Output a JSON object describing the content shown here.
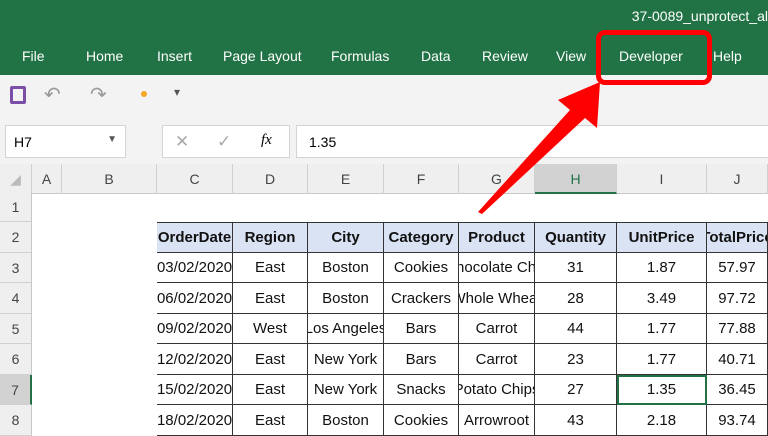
{
  "window": {
    "title": "37-0089_unprotect_al"
  },
  "menu": [
    "File",
    "Home",
    "Insert",
    "Page Layout",
    "Formulas",
    "Data",
    "Review",
    "View",
    "Developer",
    "Help"
  ],
  "colors": {
    "ribbon": "#217346",
    "highlight": "#ff0000",
    "selection": "#217346",
    "header_fill": "#dae3f3"
  },
  "qat": {
    "icons": [
      "save-icon",
      "undo-icon",
      "redo-icon",
      "touch-mode-icon",
      "customize-icon"
    ]
  },
  "formula_bar": {
    "name_box": "H7",
    "fx": "fx",
    "value": "1.35"
  },
  "columns": [
    "A",
    "B",
    "C",
    "D",
    "E",
    "F",
    "G",
    "H",
    "I",
    "J"
  ],
  "rows": [
    "1",
    "2",
    "3",
    "4",
    "5",
    "6",
    "7",
    "8"
  ],
  "table": {
    "headers": [
      "OrderDate",
      "Region",
      "City",
      "Category",
      "Product",
      "Quantity",
      "UnitPrice",
      "TotalPrice"
    ],
    "rows": [
      [
        "03/02/2020",
        "East",
        "Boston",
        "Cookies",
        "Chocolate Chip",
        "31",
        "1.87",
        "57.97"
      ],
      [
        "06/02/2020",
        "East",
        "Boston",
        "Crackers",
        "Whole Wheat",
        "28",
        "3.49",
        "97.72"
      ],
      [
        "09/02/2020",
        "West",
        "Los Angeles",
        "Bars",
        "Carrot",
        "44",
        "1.77",
        "77.88"
      ],
      [
        "12/02/2020",
        "East",
        "New York",
        "Bars",
        "Carrot",
        "23",
        "1.77",
        "40.71"
      ],
      [
        "15/02/2020",
        "East",
        "New York",
        "Snacks",
        "Potato Chips",
        "27",
        "1.35",
        "36.45"
      ],
      [
        "18/02/2020",
        "East",
        "Boston",
        "Cookies",
        "Arrowroot",
        "43",
        "2.18",
        "93.74"
      ]
    ]
  },
  "selected_cell": "H7"
}
